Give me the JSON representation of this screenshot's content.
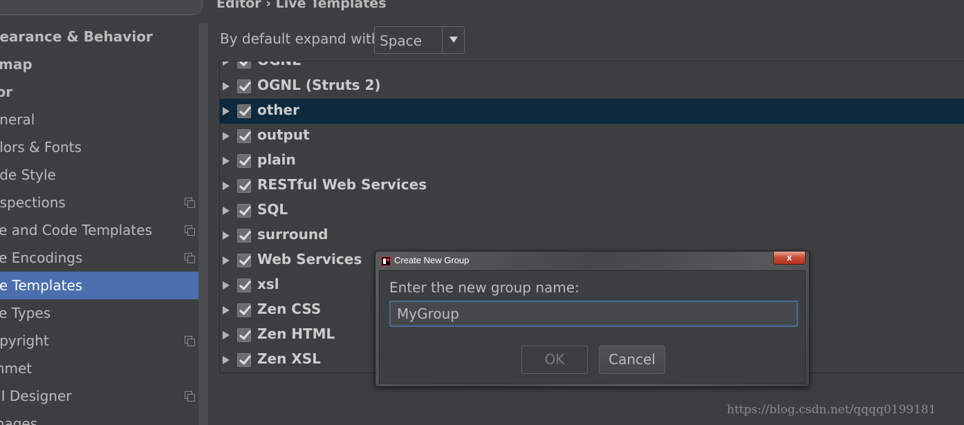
{
  "sidebar": {
    "items": [
      {
        "label": "pearance & Behavior",
        "bold": true
      },
      {
        "label": "ymap",
        "bold": true
      },
      {
        "label": "tor",
        "bold": true
      },
      {
        "label": "eneral"
      },
      {
        "label": "olors & Fonts"
      },
      {
        "label": "ode Style"
      },
      {
        "label": "nspections",
        "copy_icon": true
      },
      {
        "label": "ile and Code Templates",
        "copy_icon": true
      },
      {
        "label": "ile Encodings",
        "copy_icon": true
      },
      {
        "label": "ve Templates",
        "selected": true
      },
      {
        "label": "ile Types"
      },
      {
        "label": "opyright",
        "copy_icon": true
      },
      {
        "label": "mmet"
      },
      {
        "label": "UI Designer",
        "copy_icon": true
      },
      {
        "label": "mages"
      }
    ]
  },
  "main": {
    "breadcrumb": "Editor › Live Templates",
    "expand_label": "By default expand with",
    "expand_value": "Space",
    "template_groups": [
      {
        "label": "OGNL"
      },
      {
        "label": "OGNL (Struts 2)"
      },
      {
        "label": "other",
        "selected": true
      },
      {
        "label": "output"
      },
      {
        "label": "plain"
      },
      {
        "label": "RESTful Web Services"
      },
      {
        "label": "SQL"
      },
      {
        "label": "surround"
      },
      {
        "label": "Web Services"
      },
      {
        "label": "xsl"
      },
      {
        "label": "Zen CSS"
      },
      {
        "label": "Zen HTML"
      },
      {
        "label": "Zen XSL"
      }
    ]
  },
  "dialog": {
    "title": "Create New Group",
    "close_label": "x",
    "prompt": "Enter the new group name:",
    "input_value": "MyGroup",
    "ok_label": "OK",
    "cancel_label": "Cancel"
  },
  "watermark": "https://blog.csdn.net/qqqq0199181"
}
